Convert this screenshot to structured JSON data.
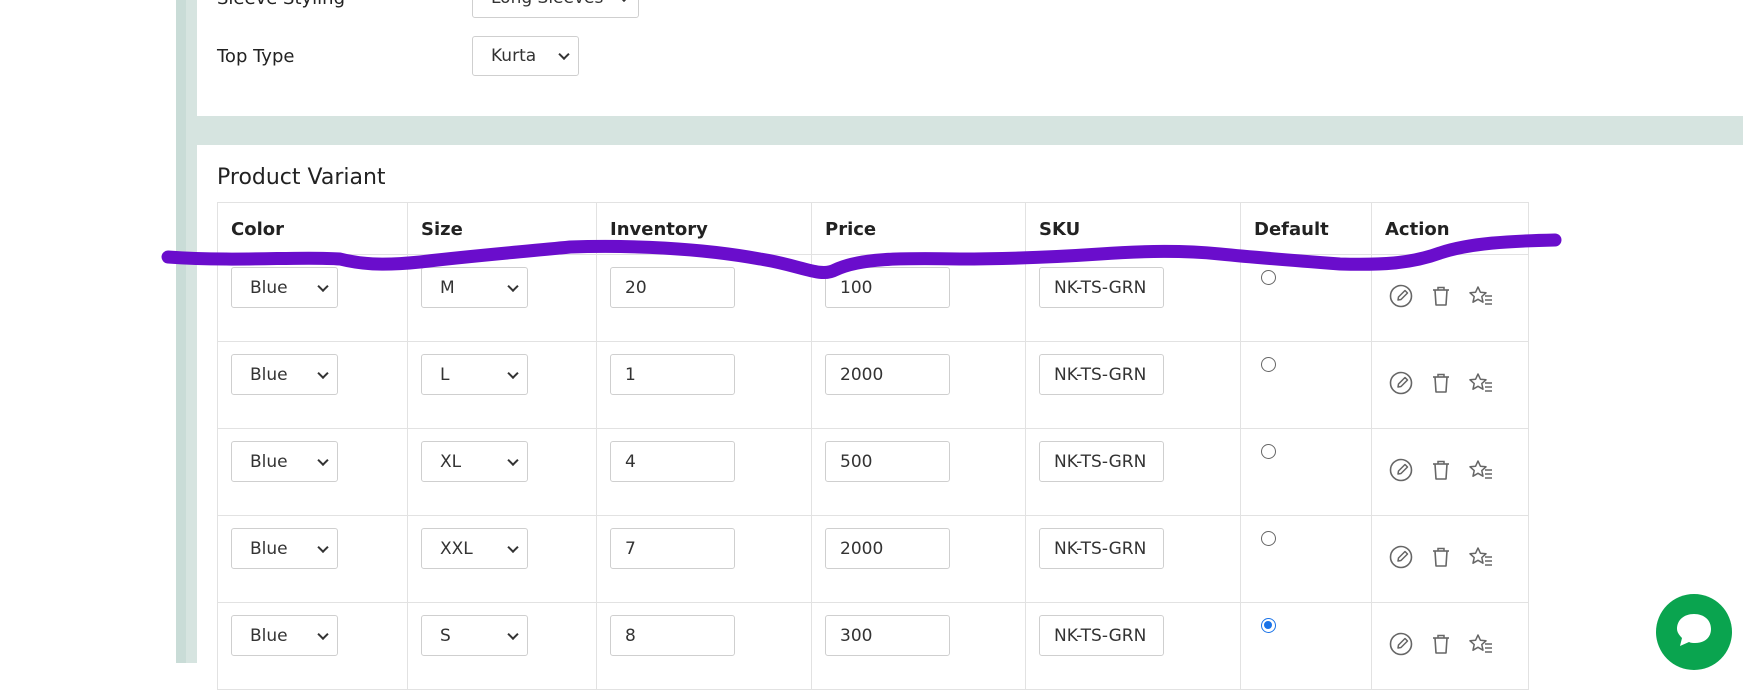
{
  "top_form": {
    "sleeve_label": "Sleeve Styling",
    "sleeve_value": "Long Sleeves",
    "top_type_label": "Top Type",
    "top_type_value": "Kurta"
  },
  "variant_section": {
    "title": "Product Variant",
    "columns": [
      "Color",
      "Size",
      "Inventory",
      "Price",
      "SKU",
      "Default",
      "Action"
    ],
    "rows": [
      {
        "color": "Blue",
        "size": "M",
        "inventory": "20",
        "price": "100",
        "sku": "NK-TS-GRN",
        "default": false
      },
      {
        "color": "Blue",
        "size": "L",
        "inventory": "1",
        "price": "2000",
        "sku": "NK-TS-GRN",
        "default": false
      },
      {
        "color": "Blue",
        "size": "XL",
        "inventory": "4",
        "price": "500",
        "sku": "NK-TS-GRN",
        "default": false
      },
      {
        "color": "Blue",
        "size": "XXL",
        "inventory": "7",
        "price": "2000",
        "sku": "NK-TS-GRN",
        "default": false
      },
      {
        "color": "Blue",
        "size": "S",
        "inventory": "8",
        "price": "300",
        "sku": "NK-TS-GRN",
        "default": true
      }
    ]
  },
  "icons": {
    "action": [
      "edit-icon",
      "trash-icon",
      "star-list-icon"
    ],
    "chat": "chat-icon"
  },
  "colors": {
    "background": "#d6e4e0",
    "card": "#ffffff",
    "selected_radio": "#1a73e8",
    "chat_button": "#0aa44f",
    "annotation_stroke": "#6a0dcc"
  }
}
